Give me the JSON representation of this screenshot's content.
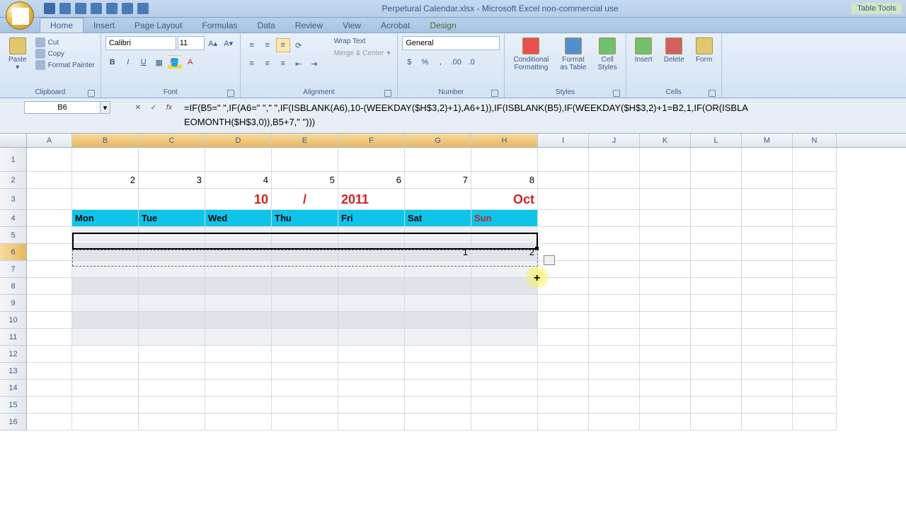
{
  "title": "Perpetural Calendar.xlsx - Microsoft Excel non-commercial use",
  "tabtools": "Table Tools",
  "tabs": [
    "Home",
    "Insert",
    "Page Layout",
    "Formulas",
    "Data",
    "Review",
    "View",
    "Acrobat",
    "Design"
  ],
  "activeTab": "Home",
  "clipboard": {
    "label": "Clipboard",
    "paste": "Paste",
    "cut": "Cut",
    "copy": "Copy",
    "format_painter": "Format Painter"
  },
  "font": {
    "label": "Font",
    "name": "Calibri",
    "size": "11"
  },
  "alignment": {
    "label": "Alignment",
    "wrap": "Wrap Text",
    "merge": "Merge & Center"
  },
  "number": {
    "label": "Number",
    "format": "General"
  },
  "styles": {
    "label": "Styles",
    "cond": "Conditional\nFormatting",
    "table": "Format\nas Table",
    "cell": "Cell\nStyles"
  },
  "cells": {
    "label": "Cells",
    "insert": "Insert",
    "delete": "Delete",
    "format": "Form"
  },
  "name_box": "B6",
  "formula": "=IF(B5=\" \",IF(A6=\" \",\" \",IF(ISBLANK(A6),10-(WEEKDAY($H$3,2)+1),A6+1)),IF(ISBLANK(B5),IF(WEEKDAY($H$3,2)+1=B2,1,IF(OR(ISBLA",
  "formula_line2": "EOMONTH($H$3,0)),B5+7,\" \")))",
  "columns": [
    "A",
    "B",
    "C",
    "D",
    "E",
    "F",
    "G",
    "H",
    "I",
    "J",
    "K",
    "L",
    "M",
    "N"
  ],
  "row2": [
    "",
    "2",
    "3",
    "4",
    "5",
    "6",
    "7",
    "8",
    "",
    "",
    "",
    "",
    "",
    ""
  ],
  "row3": {
    "D": "10",
    "E": "/",
    "F": "2011",
    "H": "Oct"
  },
  "row4": [
    "Mon",
    "Tue",
    "Wed",
    "Thu",
    "Fri",
    "Sat",
    "Sun"
  ],
  "row6": {
    "G": "1",
    "H": "2"
  },
  "rows_shown": 16
}
